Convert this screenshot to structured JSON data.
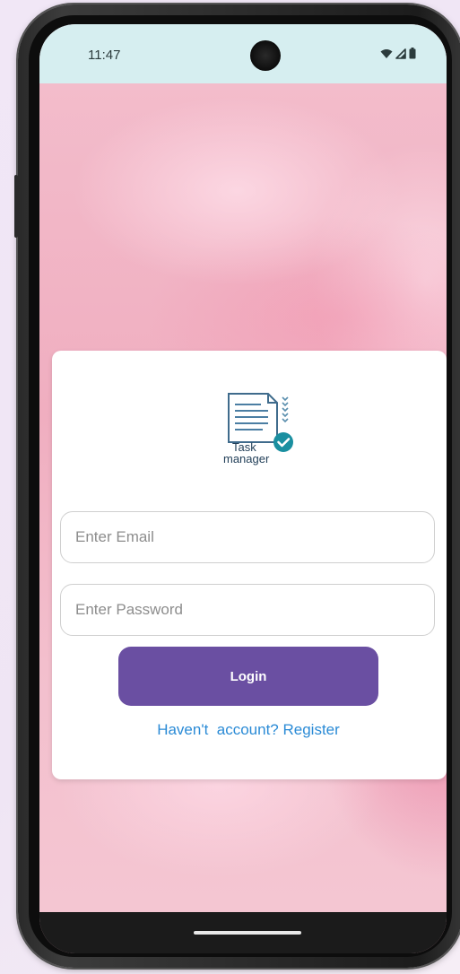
{
  "status_bar": {
    "time": "11:47",
    "icons": [
      "wifi-icon",
      "signal-icon",
      "battery-icon"
    ],
    "background": "#d6eef0"
  },
  "login_card": {
    "logo": {
      "icon": "task-document-check-icon",
      "text_line1": "Task",
      "text_line2": "manager",
      "check_color": "#1a8fa0"
    },
    "email": {
      "placeholder": "Enter Email",
      "value": ""
    },
    "password": {
      "placeholder": "Enter Password",
      "value": ""
    },
    "login_label": "Login",
    "register_link": "Haven't  account? Register"
  },
  "colors": {
    "primary_button": "#6a4fa2",
    "link": "#2b8bd6",
    "wallpaper": "#f2b9c9"
  }
}
